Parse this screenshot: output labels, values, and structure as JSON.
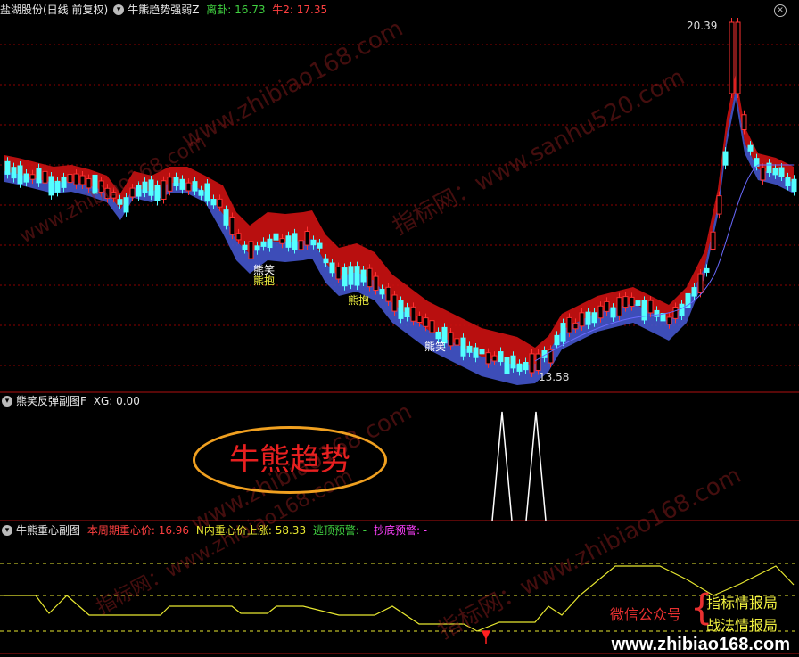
{
  "main_header": {
    "stock": "盐湖股份(日线 前复权)",
    "indicator": "牛熊趋势强弱Z",
    "lijie_label": "离卦: 16.73",
    "niu2_label": "牛2: 17.35"
  },
  "sub1_header": {
    "indicator": "熊笑反弹副图F",
    "xg_label": "XG: 0.00"
  },
  "sub2_header": {
    "indicator": "牛熊重心副图",
    "period_center": "本周期重心价: 16.96",
    "n_rise": "N内重心价上涨: 58.33",
    "escape_top": "逃顶预警: -",
    "bottom_fish": "抄底预警: -"
  },
  "price_labels": {
    "high": "20.39",
    "low": "13.58"
  },
  "bear_labels": [
    "熊笑",
    "熊抱",
    "熊抱",
    "熊笑"
  ],
  "badge_text": "牛熊趋势",
  "promo": {
    "wechat": "微信公众号",
    "line1": "指标情报局",
    "line2": "战法情报局",
    "site": "www.zhibiao168.com"
  },
  "watermarks": [
    "www.zhibiao168.com",
    "指标网：www.sanhu520.com",
    "指标网：www.zhibiao168.com"
  ],
  "colors": {
    "up": "#ff3232",
    "down": "#54ffff",
    "bull_band": "#cc1111",
    "bear_band": "#4455cc",
    "yellow": "#e8e830",
    "green": "#40d040",
    "grid": "#8b0000"
  }
}
